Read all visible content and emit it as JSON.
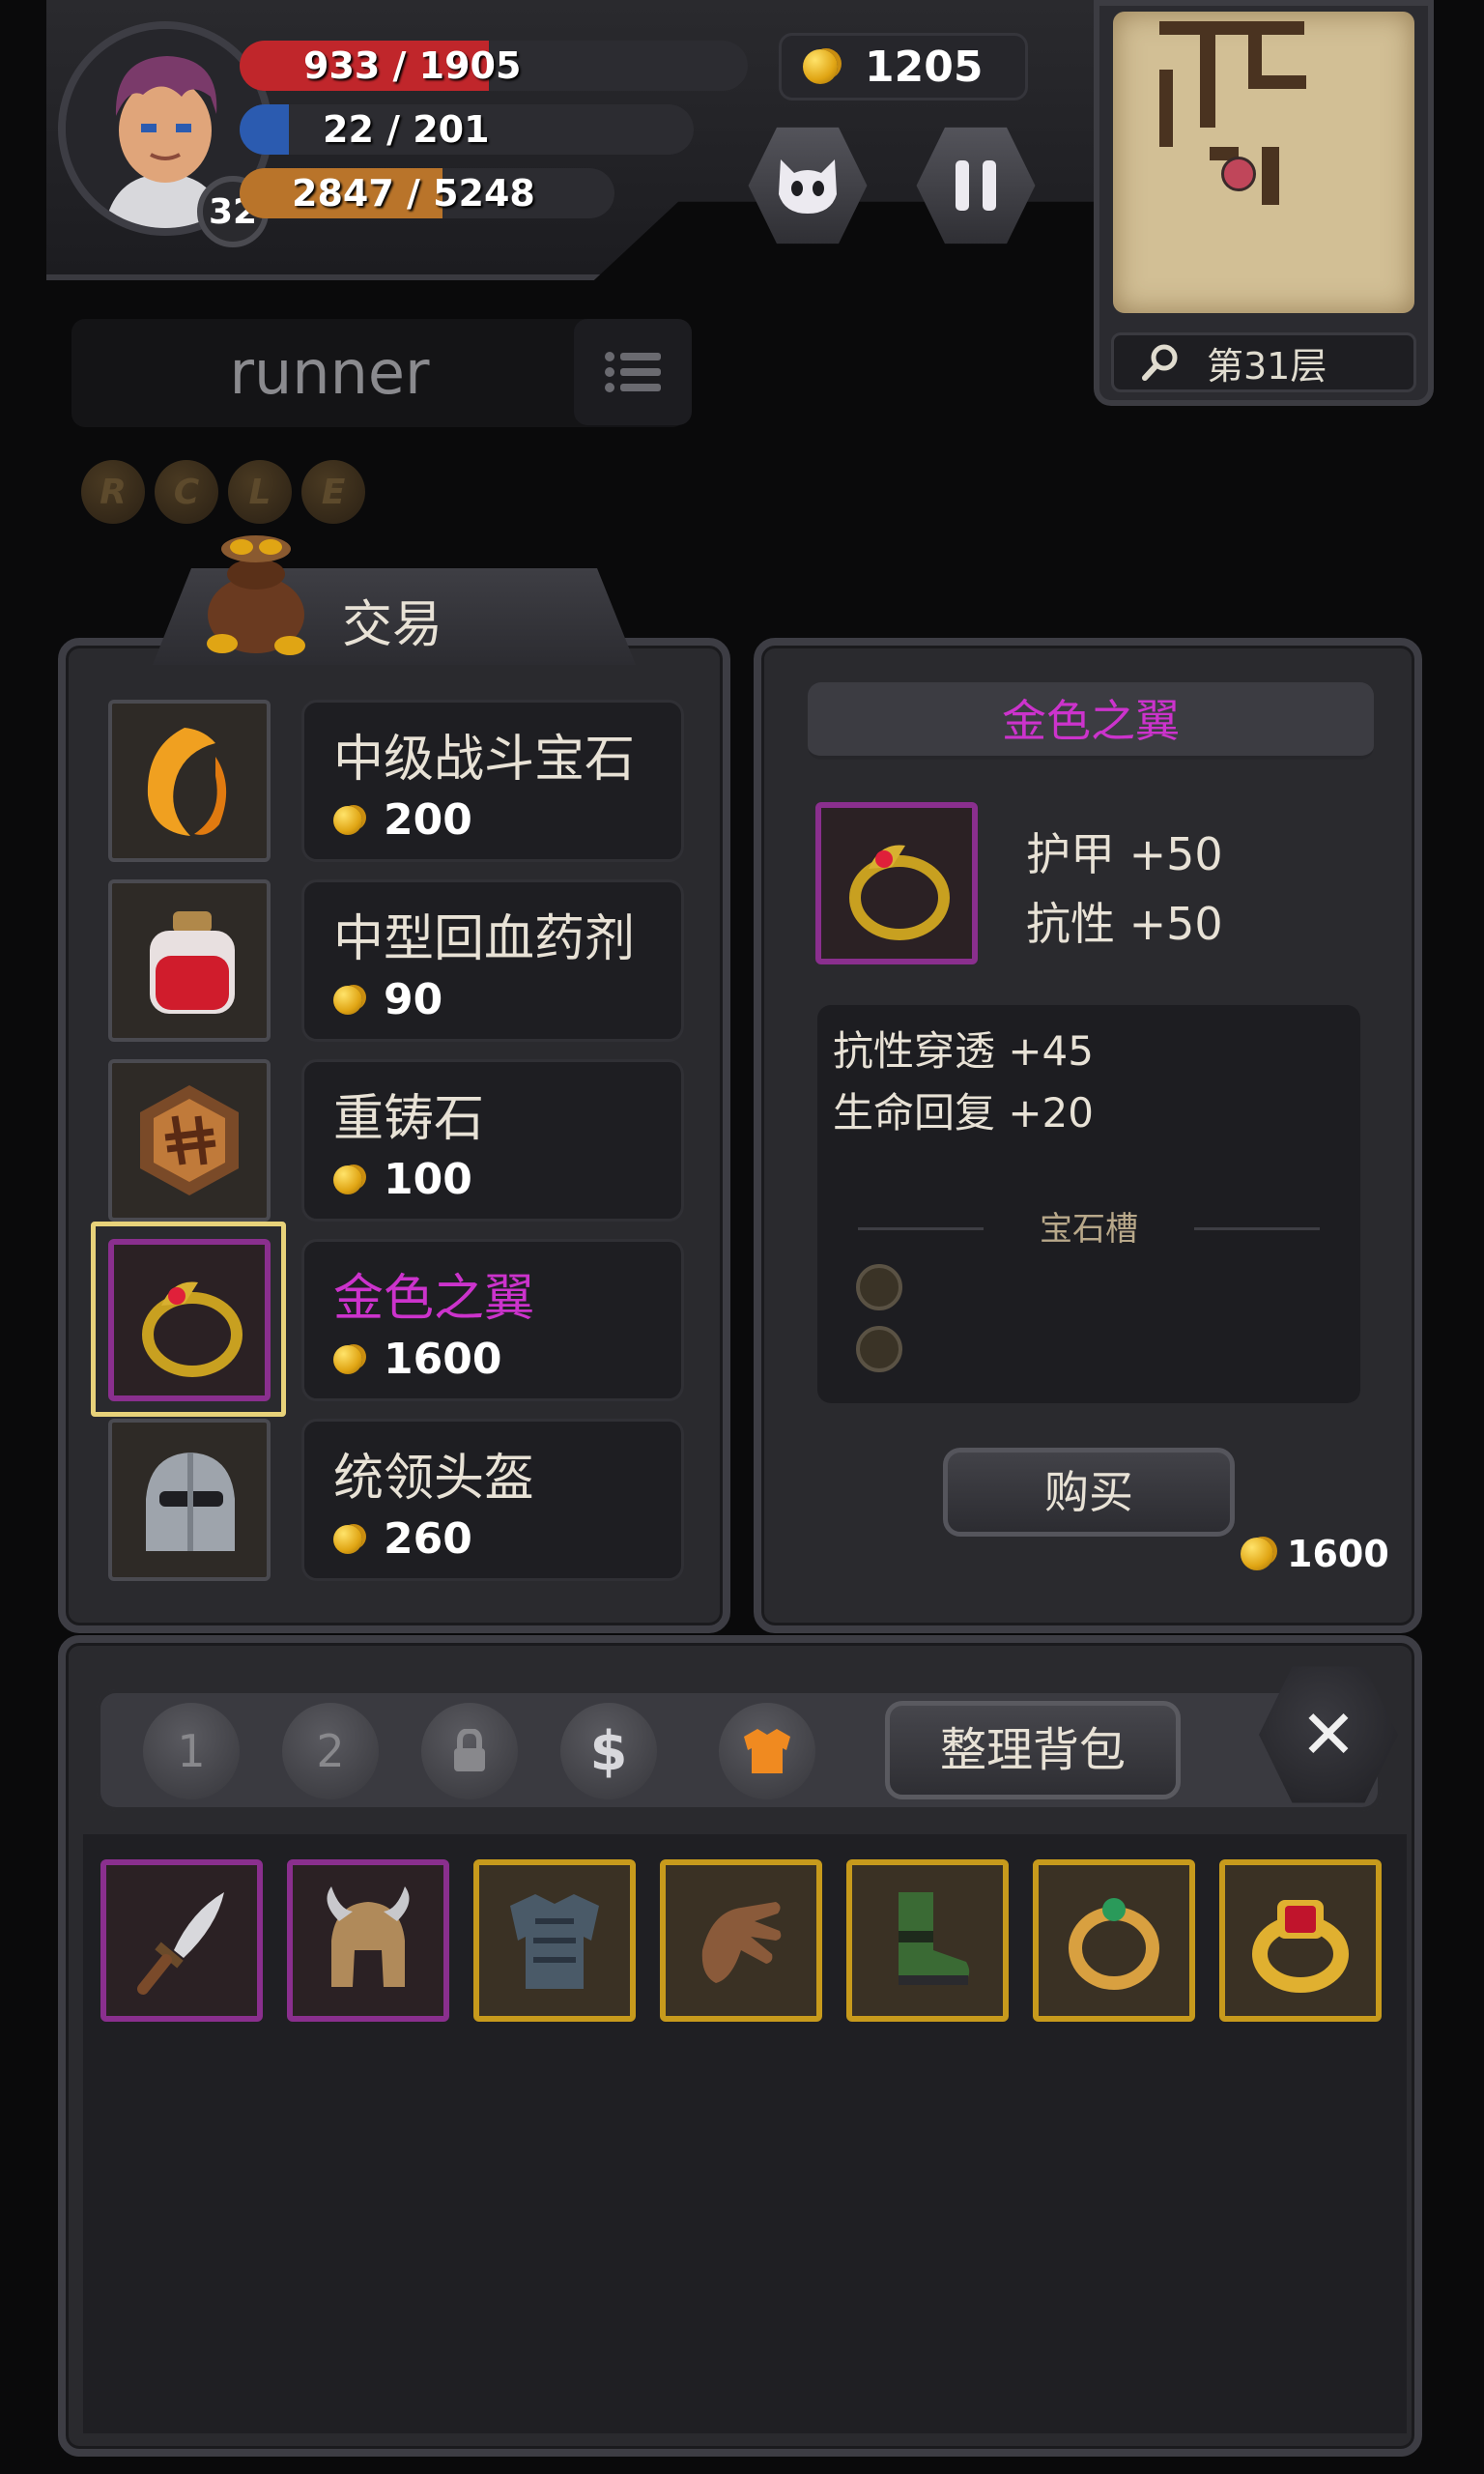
{
  "hud": {
    "hp": {
      "current": 933,
      "max": 1905,
      "text": "933 / 1905",
      "color": "#c0262b"
    },
    "mp": {
      "current": 22,
      "max": 201,
      "text": "22 / 201",
      "color": "#2b5bb0"
    },
    "xp": {
      "current": 2847,
      "max": 5248,
      "text": "2847 / 5248",
      "color": "#b9742a"
    },
    "level": "32",
    "gold": "1205",
    "floor_label": "第31层"
  },
  "player": {
    "name": "runner"
  },
  "runes": [
    "R",
    "C",
    "L",
    "E"
  ],
  "shop": {
    "title": "交易",
    "items": [
      {
        "name": "中级战斗宝石",
        "price": "200",
        "rarity": "normal",
        "icon": "fire-gem-icon"
      },
      {
        "name": "中型回血药剂",
        "price": "90",
        "rarity": "normal",
        "icon": "health-potion-icon"
      },
      {
        "name": "重铸石",
        "price": "100",
        "rarity": "normal",
        "icon": "reforge-stone-icon"
      },
      {
        "name": "金色之翼",
        "price": "1600",
        "rarity": "epic",
        "icon": "golden-ring-icon",
        "selected": true
      },
      {
        "name": "统领头盔",
        "price": "260",
        "rarity": "normal",
        "icon": "steel-helmet-icon"
      }
    ]
  },
  "detail": {
    "title": "金色之翼",
    "main_stats": [
      "护甲 +50",
      "抗性 +50"
    ],
    "extra_stats": [
      "抗性穿透 +45",
      "生命回复 +20"
    ],
    "gem_slot_label": "宝石槽",
    "gem_slots": 2,
    "buy_label": "购买",
    "price": "1600"
  },
  "inventory": {
    "tabs": [
      "1",
      "2"
    ],
    "sort_label": "整理背包",
    "items": [
      {
        "icon": "dagger-icon",
        "rarity": "epic"
      },
      {
        "icon": "horned-helmet-icon",
        "rarity": "epic"
      },
      {
        "icon": "chest-armor-icon",
        "rarity": "legendary"
      },
      {
        "icon": "leather-gloves-icon",
        "rarity": "legendary"
      },
      {
        "icon": "green-boots-icon",
        "rarity": "legendary"
      },
      {
        "icon": "emerald-ring-icon",
        "rarity": "legendary"
      },
      {
        "icon": "ruby-ring-icon",
        "rarity": "legendary"
      }
    ]
  },
  "colors": {
    "epic": "#cc33cc",
    "legendary": "#c79a1c",
    "gold": "#f0b420"
  }
}
